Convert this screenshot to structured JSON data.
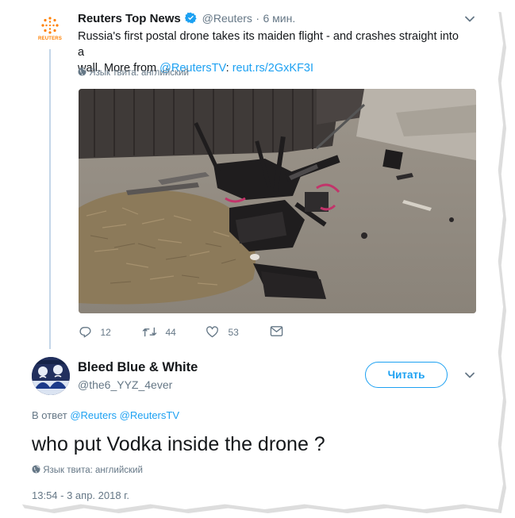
{
  "reuters_tweet": {
    "author_name": "Reuters Top News",
    "handle": "@Reuters",
    "separator": "·",
    "time": "6 мин.",
    "text_line1": "Russia's first postal drone takes its maiden flight - and crashes straight into a",
    "text_line2_prefix": "wall. More from ",
    "mention": "@ReutersTV",
    "colon": ":",
    "url": "reut.rs/2GxKF3I",
    "language_note": "Язык твита: английский",
    "logo_text": "REUTERS",
    "actions": {
      "replies": "12",
      "retweets": "44",
      "likes": "53"
    }
  },
  "reply_tweet": {
    "author_name": "Bleed Blue & White",
    "handle": "@the6_YYZ_4ever",
    "follow_label": "Читать",
    "reply_to_prefix": "В ответ",
    "reply_to_mentions": "@Reuters @ReutersTV",
    "text": "who put Vodka inside the drone ?",
    "language_note": "Язык твита: английский",
    "timestamp": "13:54 - 3 апр. 2018 г."
  },
  "colors": {
    "link": "#1da1f2",
    "muted": "#657786",
    "verified": "#1da1f2",
    "reuters_orange": "#ff8000"
  },
  "icons": [
    "reply-icon",
    "retweet-icon",
    "like-icon",
    "message-icon",
    "globe-icon",
    "verified-badge-icon",
    "chevron-down-icon"
  ]
}
